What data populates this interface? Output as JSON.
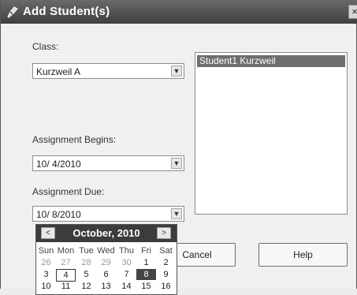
{
  "window": {
    "title": "Add Student(s)",
    "close_glyph": "×",
    "icon": "app-pen-icon"
  },
  "class_field": {
    "label": "Class:",
    "value": "Kurzweil A"
  },
  "assignment_begins": {
    "label": "Assignment Begins:",
    "value": "10/ 4/2010"
  },
  "assignment_due": {
    "label": "Assignment Due:",
    "value": "10/ 8/2010"
  },
  "students_list": {
    "items": [
      "Student1 Kurzweil"
    ],
    "selected_index": 0
  },
  "buttons": {
    "cancel": "Cancel",
    "help": "Help"
  },
  "calendar": {
    "month_label": "October, 2010",
    "prev_glyph": "<",
    "next_glyph": ">",
    "weekdays": [
      "Sun",
      "Mon",
      "Tue",
      "Wed",
      "Thu",
      "Fri",
      "Sat"
    ],
    "weeks": [
      [
        "26",
        "27",
        "28",
        "29",
        "30",
        "1",
        "2"
      ],
      [
        "3",
        "4",
        "5",
        "6",
        "7",
        "8",
        "9"
      ],
      [
        "10",
        "11",
        "12",
        "13",
        "14",
        "15",
        "16"
      ]
    ],
    "today": "4",
    "selected": "8"
  }
}
